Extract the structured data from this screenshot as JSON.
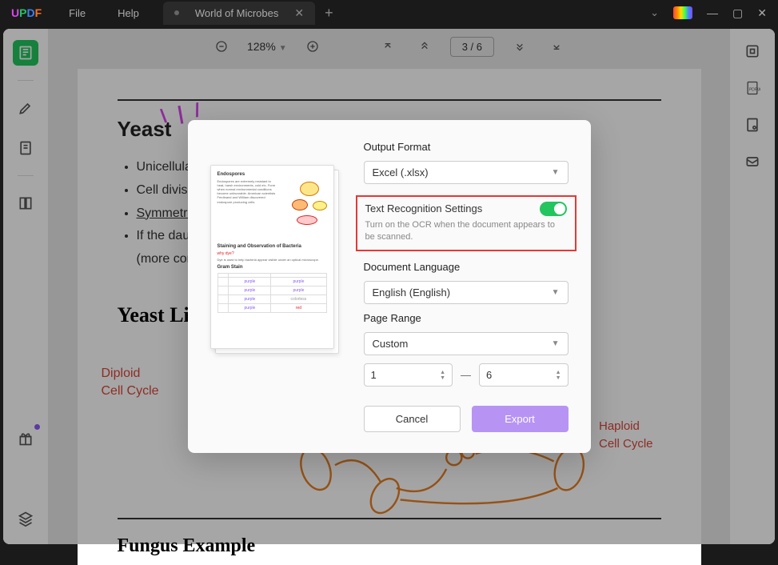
{
  "titlebar": {
    "menu_file": "File",
    "menu_help": "Help",
    "tab_title": "World of Microbes"
  },
  "toolbar": {
    "zoom": "128%",
    "page": "3  /  6"
  },
  "doc": {
    "heading1": "Yeast",
    "bullet1": "Unicellular fungi",
    "bullet2": "Cell division by budding",
    "bullet3": "Symmetrical division",
    "bullet4a": "If the daughter cell buds but remain attach, the resultant structure is",
    "bullet4b": "(more common in yeast with same characteristics)",
    "heading2": "Yeast Life Cycle",
    "handnote1a": "Diploid",
    "handnote1b": "Cell Cycle",
    "handnote2a": "Haploid",
    "handnote2b": "Cell Cycle",
    "heading3": "Fungus Example"
  },
  "dialog": {
    "output_format_label": "Output Format",
    "output_format_value": "Excel (.xlsx)",
    "ocr_title": "Text Recognition Settings",
    "ocr_desc": "Turn on the OCR when the document appears to be scanned.",
    "lang_label": "Document Language",
    "lang_value": "English (English)",
    "range_label": "Page Range",
    "range_value": "Custom",
    "range_from": "1",
    "range_to": "6",
    "cancel": "Cancel",
    "export": "Export"
  }
}
